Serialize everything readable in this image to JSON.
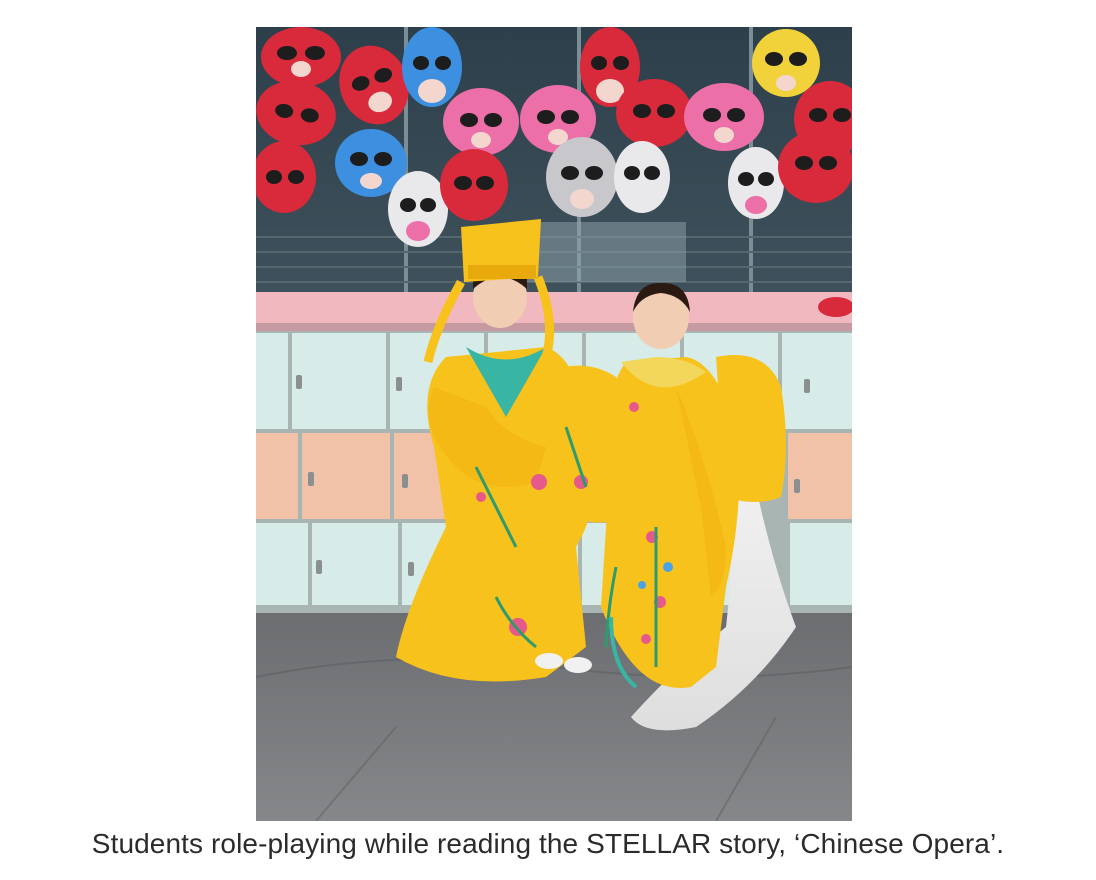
{
  "figure": {
    "caption": "Students role-playing while reading the STELLAR story, ‘Chinese Opera’.",
    "photo_alt": "Two young students dressed in yellow embroidered Chinese opera costumes standing in front of lockers, with colourful Chinese opera masks hanging on the wall above them."
  },
  "colors": {
    "costume_yellow": "#f7c21b",
    "mask_red": "#d82a3a",
    "mask_pink": "#ec6fa8",
    "mask_blue": "#3d8fe0",
    "mask_yellow": "#f2d23a",
    "mask_white": "#e9e9ec",
    "locker_mint": "#d7ece8",
    "locker_peach": "#f2c2a8",
    "floor": "#76787a",
    "caption_text": "#2b2b2b"
  }
}
